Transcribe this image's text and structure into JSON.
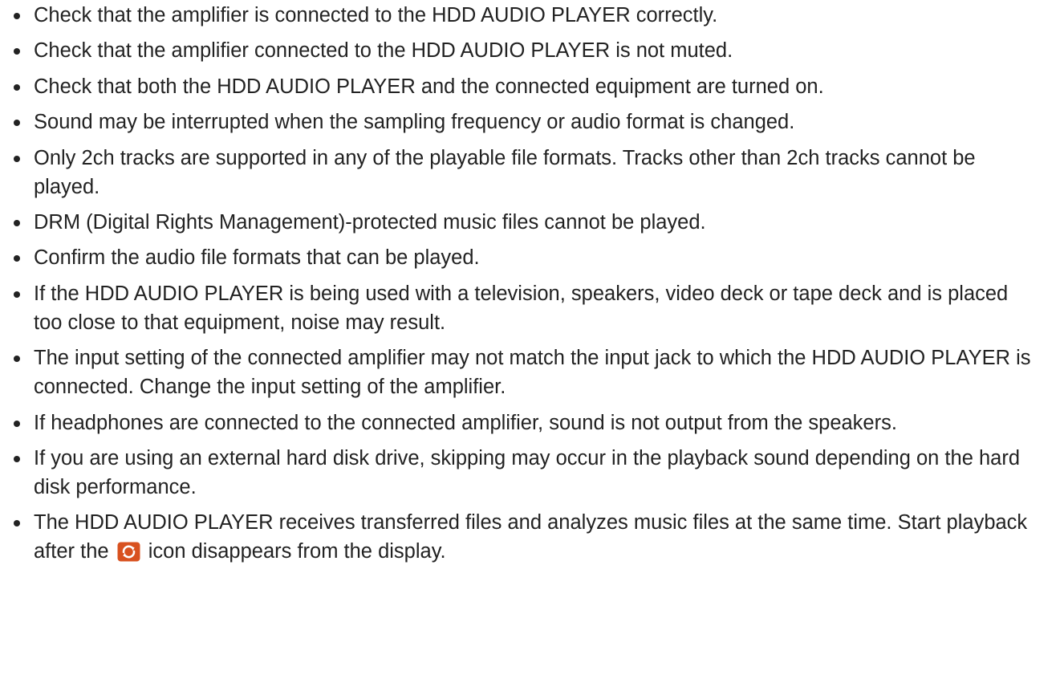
{
  "items": [
    "Check that the amplifier is connected to the HDD AUDIO PLAYER correctly.",
    "Check that the amplifier connected to the HDD AUDIO PLAYER is not muted.",
    "Check that both the HDD AUDIO PLAYER and the connected equipment are turned on.",
    "Sound may be interrupted when the sampling frequency or audio format is changed.",
    "Only 2ch tracks are supported in any of the playable file formats. Tracks other than 2ch tracks cannot be played.",
    "DRM (Digital Rights Management)-protected music files cannot be played.",
    "Confirm the audio file formats that can be played.",
    "If the HDD AUDIO PLAYER is being used with a television, speakers, video deck or tape deck and is placed too close to that equipment, noise may result.",
    "The input setting of the connected amplifier may not match the input jack to which the HDD AUDIO PLAYER is connected. Change the input setting of the amplifier.",
    "If headphones are connected to the connected amplifier, sound is not output from the speakers.",
    "If you are using an external hard disk drive, skipping may occur in the playback sound depending on the hard disk performance."
  ],
  "last_item": {
    "before_icon": "The HDD AUDIO PLAYER receives transferred files and analyzes music files at the same time. Start playback after the",
    "icon": "refresh-icon",
    "after_icon": "icon disappears from the display."
  },
  "colors": {
    "text": "#222222",
    "icon_bg": "#d8511f",
    "icon_fg": "#ffffff"
  }
}
